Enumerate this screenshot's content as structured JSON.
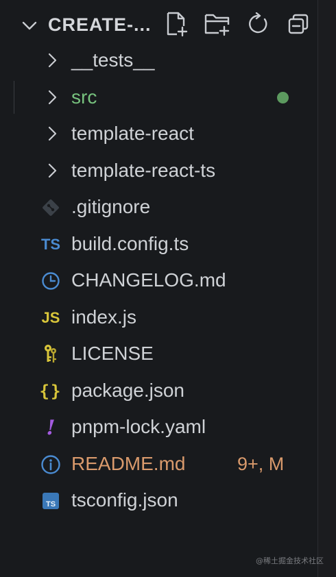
{
  "explorer": {
    "title": "CREATE-...",
    "actions": [
      {
        "name": "new-file-icon"
      },
      {
        "name": "new-folder-icon"
      },
      {
        "name": "refresh-icon"
      },
      {
        "name": "collapse-all-icon"
      }
    ]
  },
  "tree": {
    "items": [
      {
        "type": "folder",
        "label": "__tests__",
        "icon": "chevron-right-icon"
      },
      {
        "type": "folder",
        "label": "src",
        "icon": "chevron-right-icon",
        "color": "#77c27e",
        "modified_dot": true
      },
      {
        "type": "folder",
        "label": "template-react",
        "icon": "chevron-right-icon"
      },
      {
        "type": "folder",
        "label": "template-react-ts",
        "icon": "chevron-right-icon"
      },
      {
        "type": "file",
        "label": ".gitignore",
        "icon": "git-icon"
      },
      {
        "type": "file",
        "label": "build.config.ts",
        "icon": "typescript-icon",
        "icon_text": "TS"
      },
      {
        "type": "file",
        "label": "CHANGELOG.md",
        "icon": "clock-icon"
      },
      {
        "type": "file",
        "label": "index.js",
        "icon": "javascript-icon",
        "icon_text": "JS"
      },
      {
        "type": "file",
        "label": "LICENSE",
        "icon": "license-key-icon"
      },
      {
        "type": "file",
        "label": "package.json",
        "icon": "json-braces-icon",
        "icon_text": "{}"
      },
      {
        "type": "file",
        "label": "pnpm-lock.yaml",
        "icon": "yaml-icon",
        "icon_text": "!"
      },
      {
        "type": "file",
        "label": "README.md",
        "icon": "info-icon",
        "color": "#d99a6c",
        "status": "9+, M"
      },
      {
        "type": "file",
        "label": "tsconfig.json",
        "icon": "tsconfig-icon",
        "icon_text": "TS"
      }
    ]
  },
  "watermark": "@稀土掘金技术社区"
}
